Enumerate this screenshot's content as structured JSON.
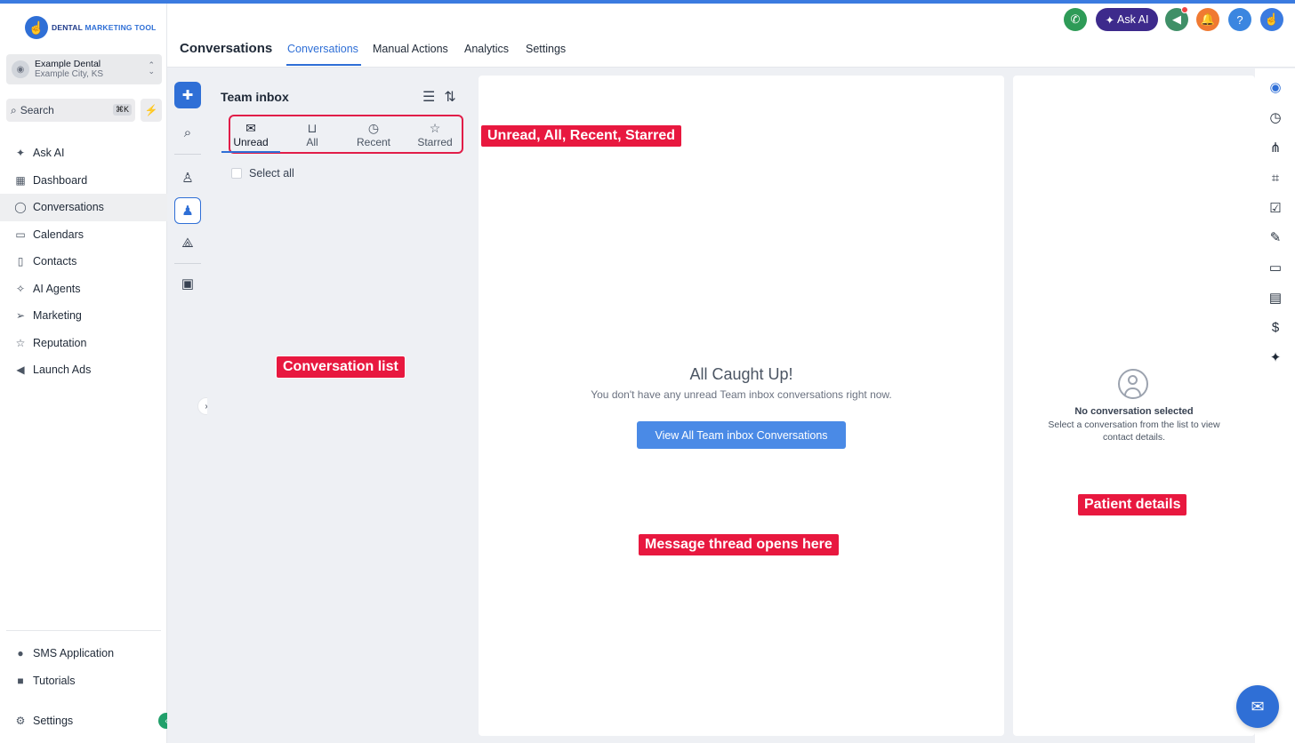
{
  "brand": {
    "logo_text_a": "DENTAL ",
    "logo_text_b": "MARKETING TOOL"
  },
  "account": {
    "name": "Example Dental",
    "location": "Example City, KS"
  },
  "search": {
    "placeholder": "Search",
    "shortcut": "⌘K"
  },
  "sidebar": {
    "items": [
      {
        "label": "Ask AI",
        "icon": "sparkle-icon"
      },
      {
        "label": "Dashboard",
        "icon": "grid-icon"
      },
      {
        "label": "Conversations",
        "icon": "chat-icon",
        "active": true
      },
      {
        "label": "Calendars",
        "icon": "calendar-icon"
      },
      {
        "label": "Contacts",
        "icon": "contacts-icon"
      },
      {
        "label": "AI Agents",
        "icon": "ai-agents-icon"
      },
      {
        "label": "Marketing",
        "icon": "send-icon"
      },
      {
        "label": "Reputation",
        "icon": "star-icon"
      },
      {
        "label": "Launch Ads",
        "icon": "megaphone-icon"
      }
    ],
    "bottom_items": [
      {
        "label": "SMS Application",
        "icon": "sms-icon"
      },
      {
        "label": "Tutorials",
        "icon": "video-icon"
      },
      {
        "label": "Settings",
        "icon": "gear-icon"
      }
    ]
  },
  "header": {
    "title": "Conversations",
    "tabs": [
      "Conversations",
      "Manual Actions",
      "Analytics",
      "Settings"
    ],
    "active_tab": "Conversations",
    "ask_ai_label": "Ask AI",
    "help_label": "?"
  },
  "list": {
    "title": "Team inbox",
    "tabs": [
      "Unread",
      "All",
      "Recent",
      "Starred"
    ],
    "active_tab": "Unread",
    "select_all_label": "Select all"
  },
  "thread": {
    "empty_title": "All Caught Up!",
    "empty_subtitle": "You don't have any unread Team inbox conversations right now.",
    "view_all_label": "View All Team inbox Conversations"
  },
  "details": {
    "empty_title": "No conversation selected",
    "empty_subtitle": "Select a conversation from the list to view contact details."
  },
  "annotations": {
    "tabs": "Unread, All, Recent, Starred",
    "conversation_list": "Conversation list",
    "message_thread": "Message thread opens here",
    "patient_details": "Patient details"
  },
  "colors": {
    "accent": "#2f6fd6",
    "annotation": "#e8183f",
    "ask_ai_bg": "#3d2a8c",
    "call_green": "#2e9b57"
  }
}
